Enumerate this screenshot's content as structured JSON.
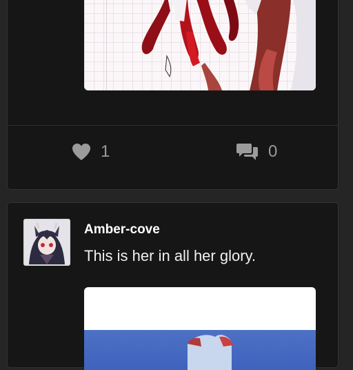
{
  "post_one": {
    "likes": "1",
    "comments": "0"
  },
  "post_two": {
    "username": "Amber-cove",
    "text": "This is her in all her glory."
  },
  "icons": {
    "like": "heart-icon",
    "comment": "speech-bubbles-icon"
  },
  "colors": {
    "background": "#252525",
    "card": "#161616",
    "action_gray": "#9b9b9b",
    "text_white": "#ffffff"
  }
}
